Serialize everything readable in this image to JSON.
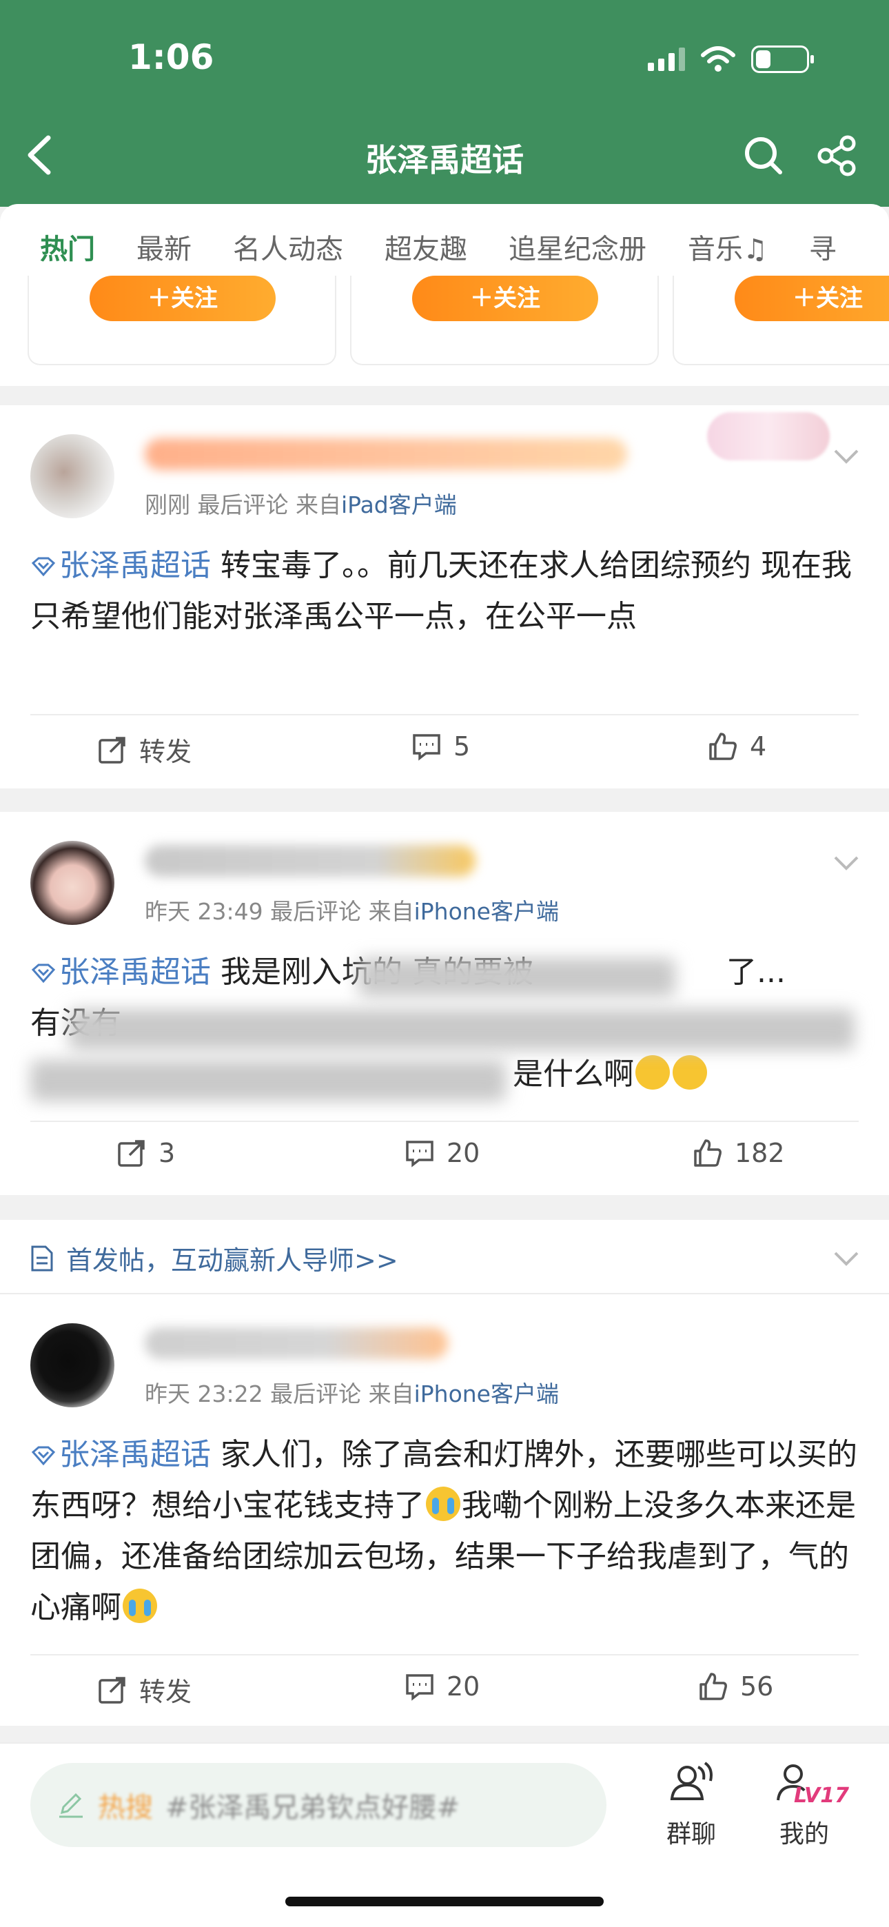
{
  "status": {
    "time": "1:06"
  },
  "nav": {
    "title": "张泽禹超话"
  },
  "tabs": [
    "热门",
    "最新",
    "名人动态",
    "超友趣",
    "追星纪念册",
    "音乐♫",
    "寻"
  ],
  "follow_label": "＋关注",
  "posts": [
    {
      "meta_time": "刚刚",
      "meta_action": "最后评论",
      "meta_from": "来自",
      "meta_source": "iPad客户端",
      "topic": "张泽禹超话",
      "text": "转宝毒了。。前几天还在求人给团综预约 现在我只希望他们能对张泽禹公平一点，在公平一点",
      "repost": "转发",
      "comments": "5",
      "likes": "4"
    },
    {
      "meta_time": "昨天 23:49",
      "meta_action": "最后评论",
      "meta_from": "来自",
      "meta_source": "iPhone客户端",
      "topic": "张泽禹超话",
      "text_visible_1": "我是刚入坑的 真的要被",
      "text_visible_2": "了...",
      "text_visible_3": "有没有",
      "text_visible_4": "是什么啊",
      "repost": "3",
      "comments": "20",
      "likes": "182"
    },
    {
      "meta_time": "昨天 23:22",
      "meta_action": "最后评论",
      "meta_from": "来自",
      "meta_source": "iPhone客户端",
      "topic": "张泽禹超话",
      "text_1": "家人们，除了高会和灯牌外，还要哪些可以买的东西呀？想给小宝花钱支持了",
      "text_2": "我嘞个刚粉上没多久本来还是团偏，还准备给团综加云包场，结果一下子给我虐到了，气的心痛啊",
      "repost": "转发",
      "comments": "20",
      "likes": "56"
    }
  ],
  "banner": {
    "text": "首发帖，互动赢新人导师>>"
  },
  "bottom": {
    "hot_label": "热搜",
    "hot_keyword": "#张泽禹兄弟钦点好腰#",
    "group_chat": "群聊",
    "mine": "我的",
    "level": "LV17"
  },
  "colors": {
    "header_green": "#3f8f5e",
    "accent_green": "#2f8f52",
    "topic_blue": "#4a7ec2",
    "follow_orange": "#ff8a18"
  }
}
